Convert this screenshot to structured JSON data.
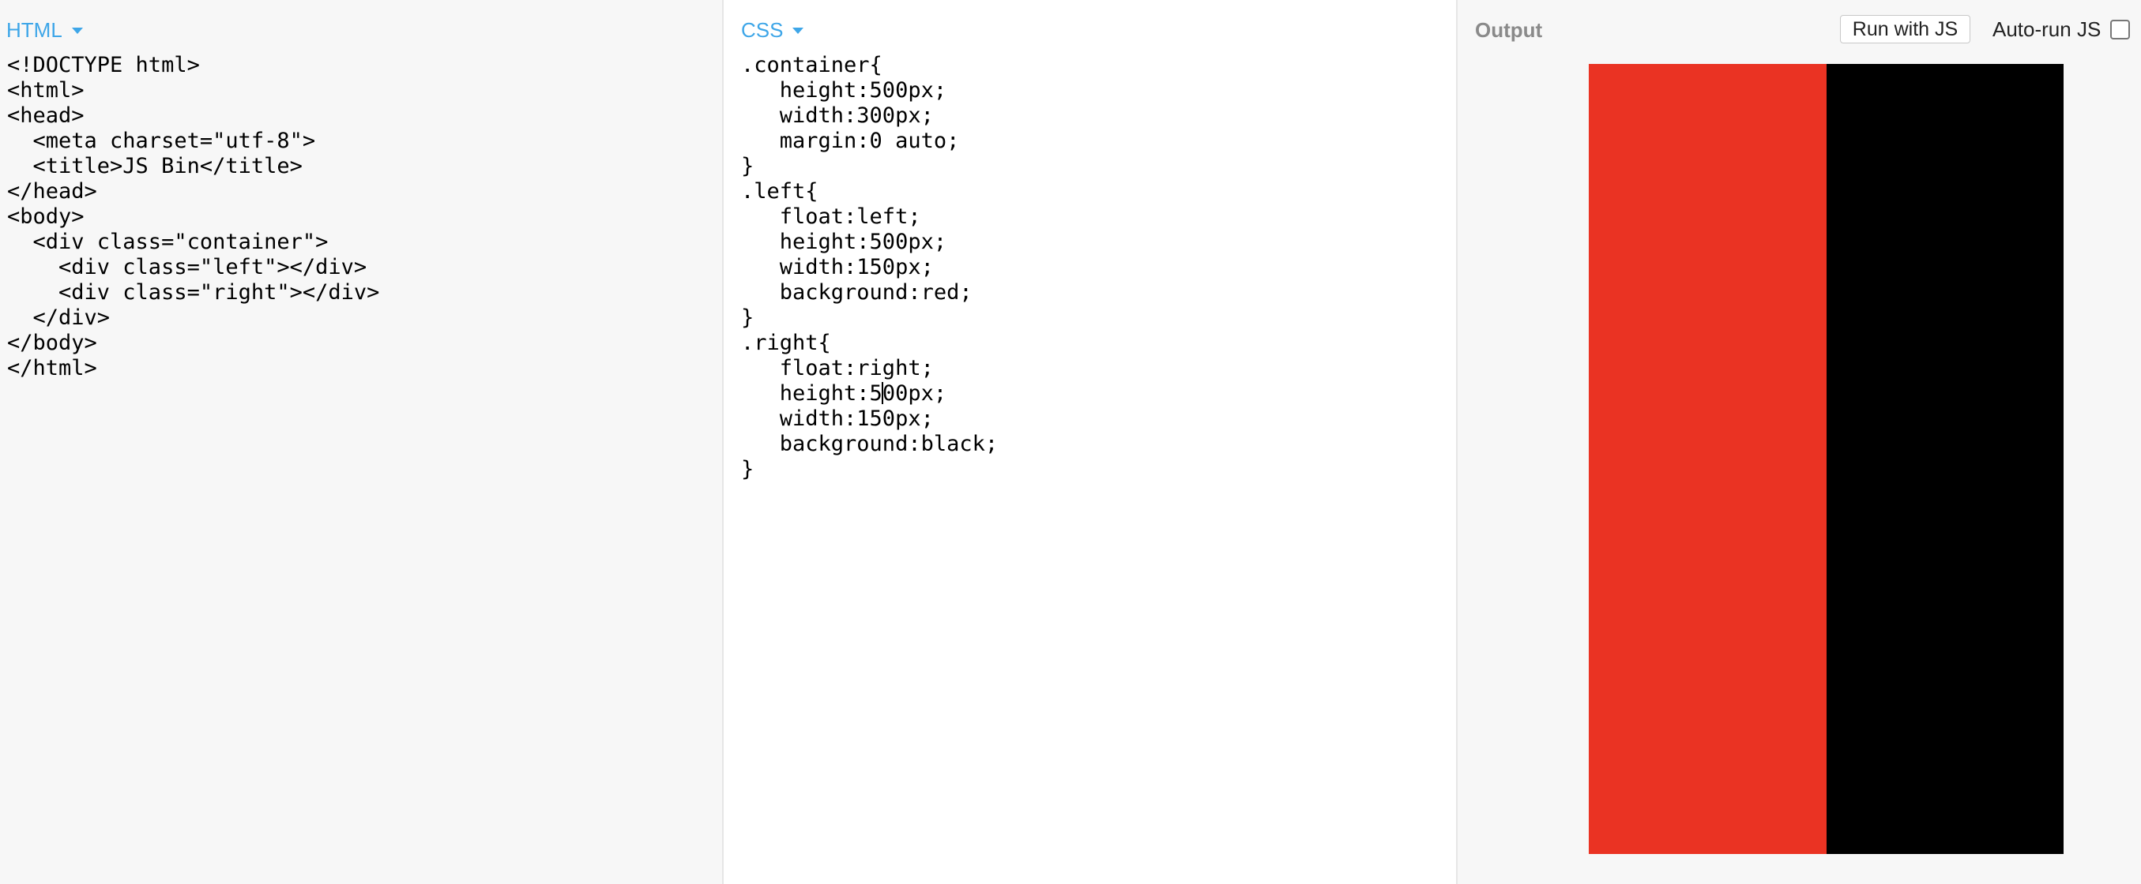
{
  "html_panel": {
    "tab_label": "HTML",
    "code_lines": [
      "<!DOCTYPE html>",
      "<html>",
      "<head>",
      "  <meta charset=\"utf-8\">",
      "  <title>JS Bin</title>",
      "</head>",
      "<body>",
      "  <div class=\"container\">",
      "    <div class=\"left\"></div>",
      "    <div class=\"right\"></div>",
      "  </div>",
      "</body>",
      "</html>"
    ]
  },
  "css_panel": {
    "tab_label": "CSS",
    "code_lines": [
      ".container{",
      "   height:500px;",
      "   width:300px;",
      "   margin:0 auto;",
      "}",
      ".left{",
      "   float:left;",
      "   height:500px;",
      "   width:150px;",
      "   background:red;",
      "}",
      ".right{",
      "   float:right;",
      "   height:5",
      "   width:150px;",
      "   background:black;",
      "}"
    ],
    "cursor_line_after": "00px;"
  },
  "output_panel": {
    "label": "Output",
    "run_button_label": "Run with JS",
    "autorun_label": "Auto-run JS",
    "autorun_checked": false
  },
  "colors": {
    "tab_accent": "#3ea6e8",
    "preview_left": "#ea3323",
    "preview_right": "#000000"
  },
  "icons": [
    "caret-down-icon"
  ]
}
